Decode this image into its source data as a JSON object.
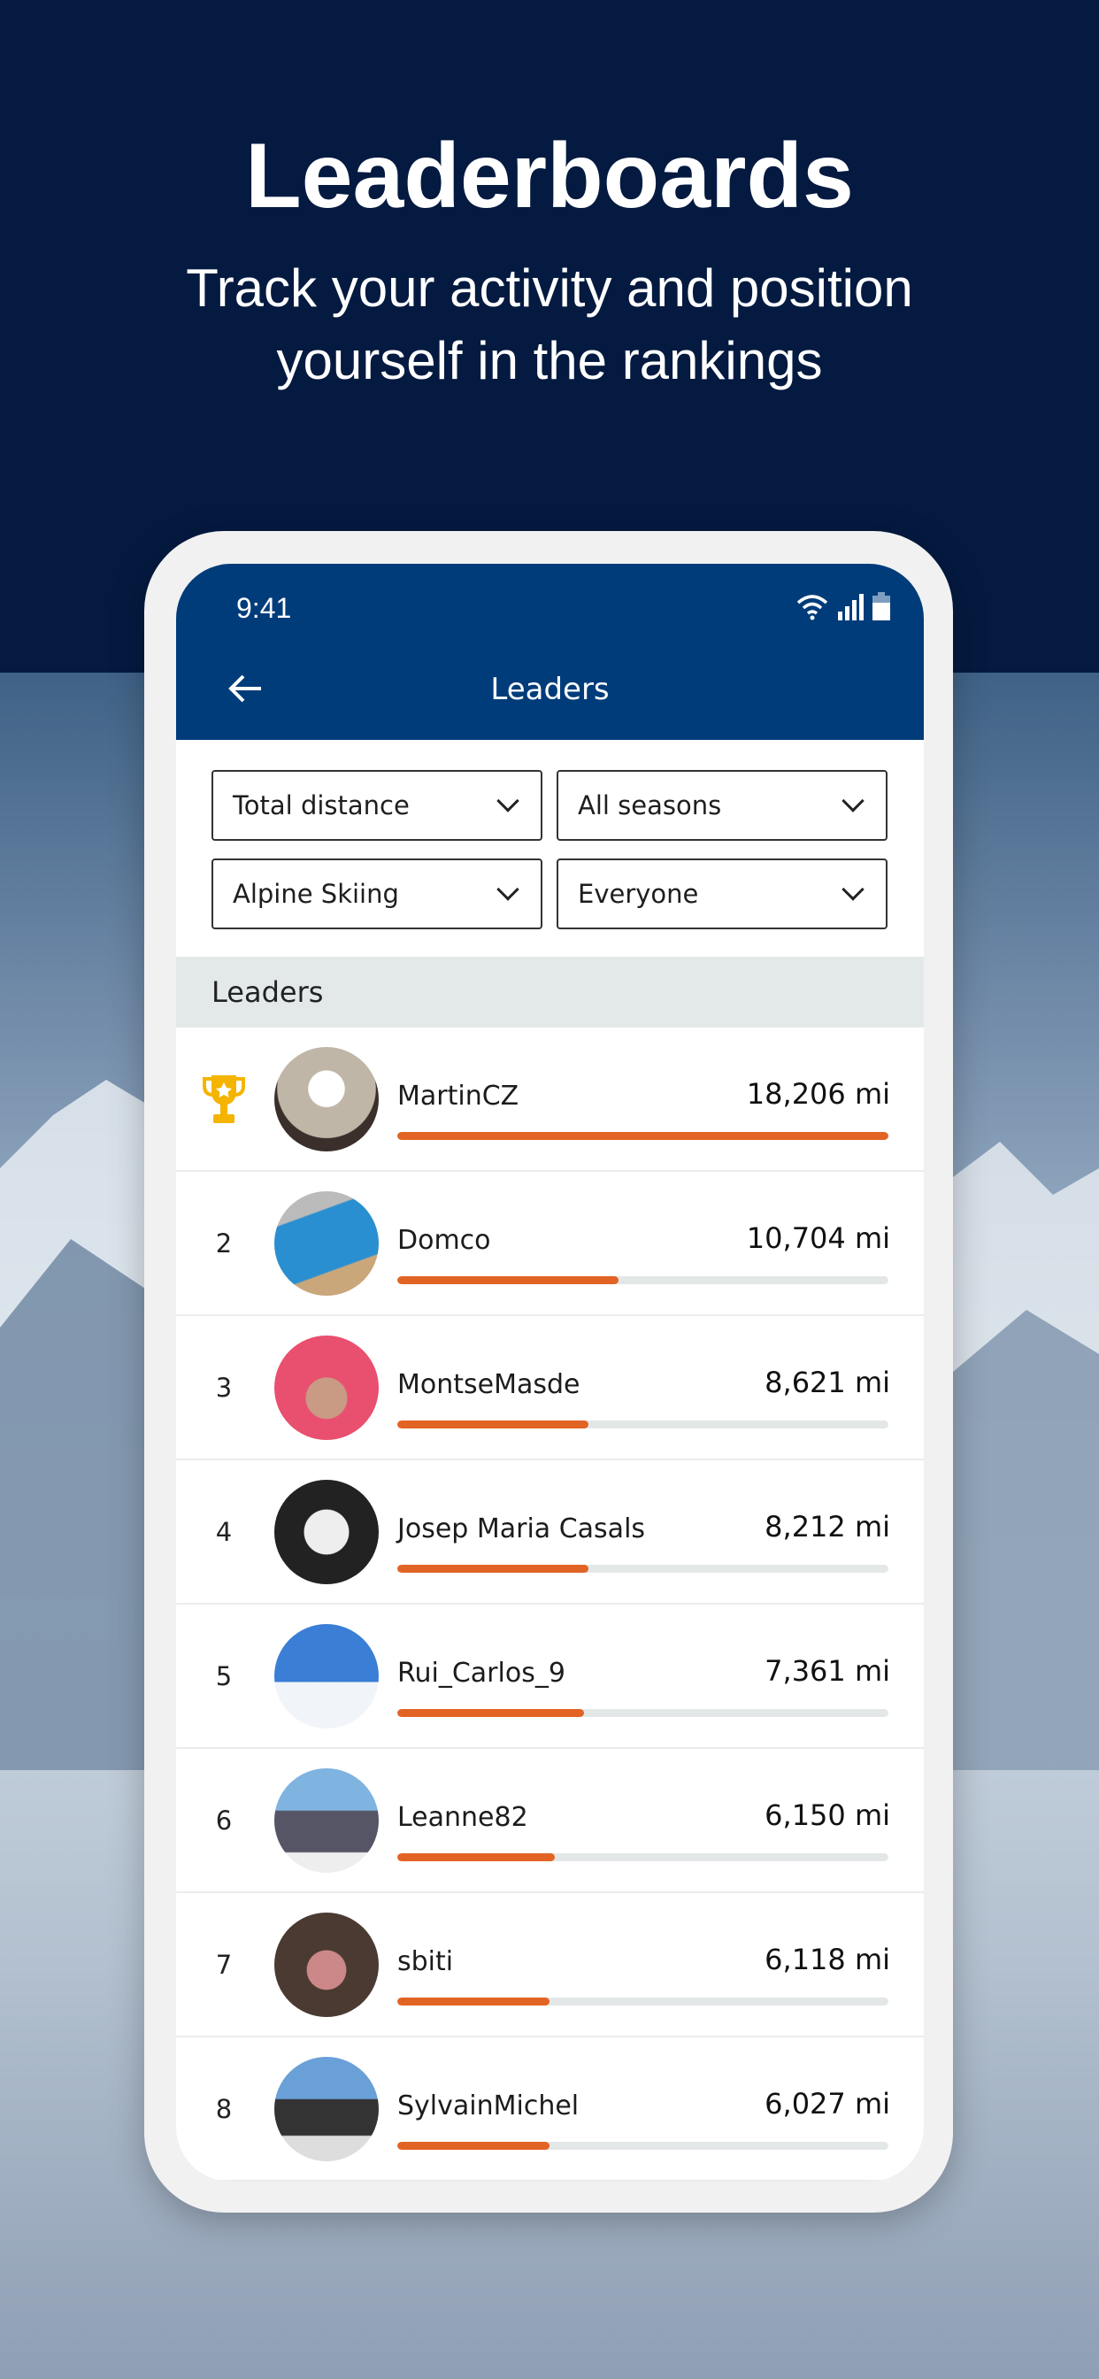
{
  "hero": {
    "title": "Leaderboards",
    "subtitle_line1": "Track your activity and position",
    "subtitle_line2": "yourself in the rankings"
  },
  "status_bar": {
    "time": "9:41",
    "icons": [
      "wifi-icon",
      "signal-icon",
      "battery-icon"
    ]
  },
  "app_header": {
    "title": "Leaders",
    "back_icon": "arrow-left-icon"
  },
  "filters": [
    {
      "value": "Total distance"
    },
    {
      "value": "All seasons"
    },
    {
      "value": "Alpine Skiing"
    },
    {
      "value": "Everyone"
    }
  ],
  "section_title": "Leaders",
  "colors": {
    "navy": "#041a40",
    "header": "#003c7a",
    "accent": "#e26424",
    "trophy": "#f5b400"
  },
  "leaders": [
    {
      "rank": "1",
      "name": "MartinCZ",
      "value": "18,206 mi",
      "progress_pct": 100,
      "first_icon": "trophy-icon"
    },
    {
      "rank": "2",
      "name": "Domco",
      "value": "10,704 mi",
      "progress_pct": 45
    },
    {
      "rank": "3",
      "name": "MontseMasde",
      "value": "8,621 mi",
      "progress_pct": 39
    },
    {
      "rank": "4",
      "name": "Josep Maria Casals",
      "value": "8,212 mi",
      "progress_pct": 39
    },
    {
      "rank": "5",
      "name": "Rui_Carlos_9",
      "value": "7,361 mi",
      "progress_pct": 38
    },
    {
      "rank": "6",
      "name": "Leanne82",
      "value": "6,150 mi",
      "progress_pct": 32
    },
    {
      "rank": "7",
      "name": "sbiti",
      "value": "6,118 mi",
      "progress_pct": 31
    },
    {
      "rank": "8",
      "name": "SylvainMichel",
      "value": "6,027 mi",
      "progress_pct": 31
    }
  ]
}
